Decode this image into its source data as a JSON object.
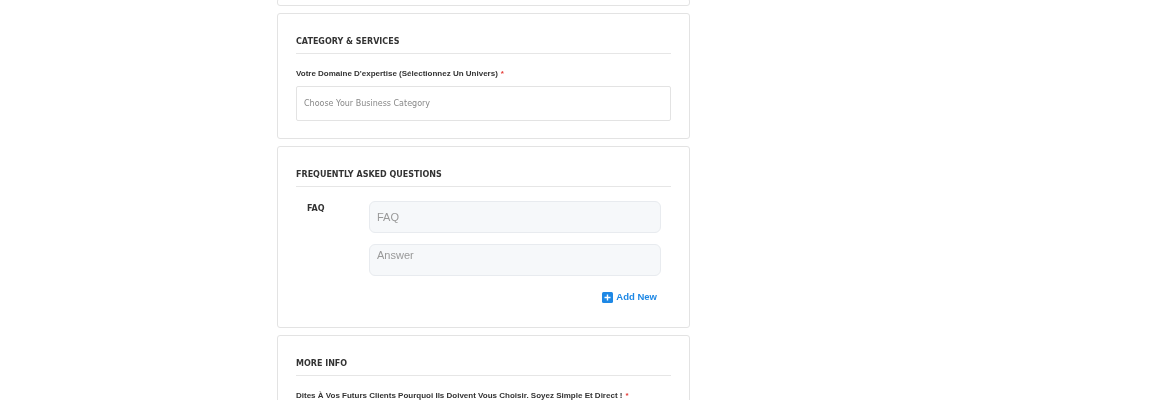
{
  "sections": [
    {
      "title": "CATEGORY & SERVICES",
      "fields": [
        {
          "kind": "select",
          "label": "Votre Domaine D'expertise (Sélectionnez Un Univers)",
          "required_mark": "*",
          "placeholder": "Choose Your Business Category"
        }
      ]
    },
    {
      "title": "FREQUENTLY ASKED QUESTIONS",
      "faq": {
        "label": "FAQ",
        "question_placeholder": "FAQ",
        "answer_placeholder": "Answer",
        "add_button": "Add New"
      }
    },
    {
      "title": "MORE INFO",
      "fields": [
        {
          "kind": "editor",
          "label": "Dites À Vos Futurs Clients Pourquoi Ils Doivent Vous Choisir. Soyez Simple Et Direct !",
          "required_mark": "*"
        }
      ]
    }
  ]
}
